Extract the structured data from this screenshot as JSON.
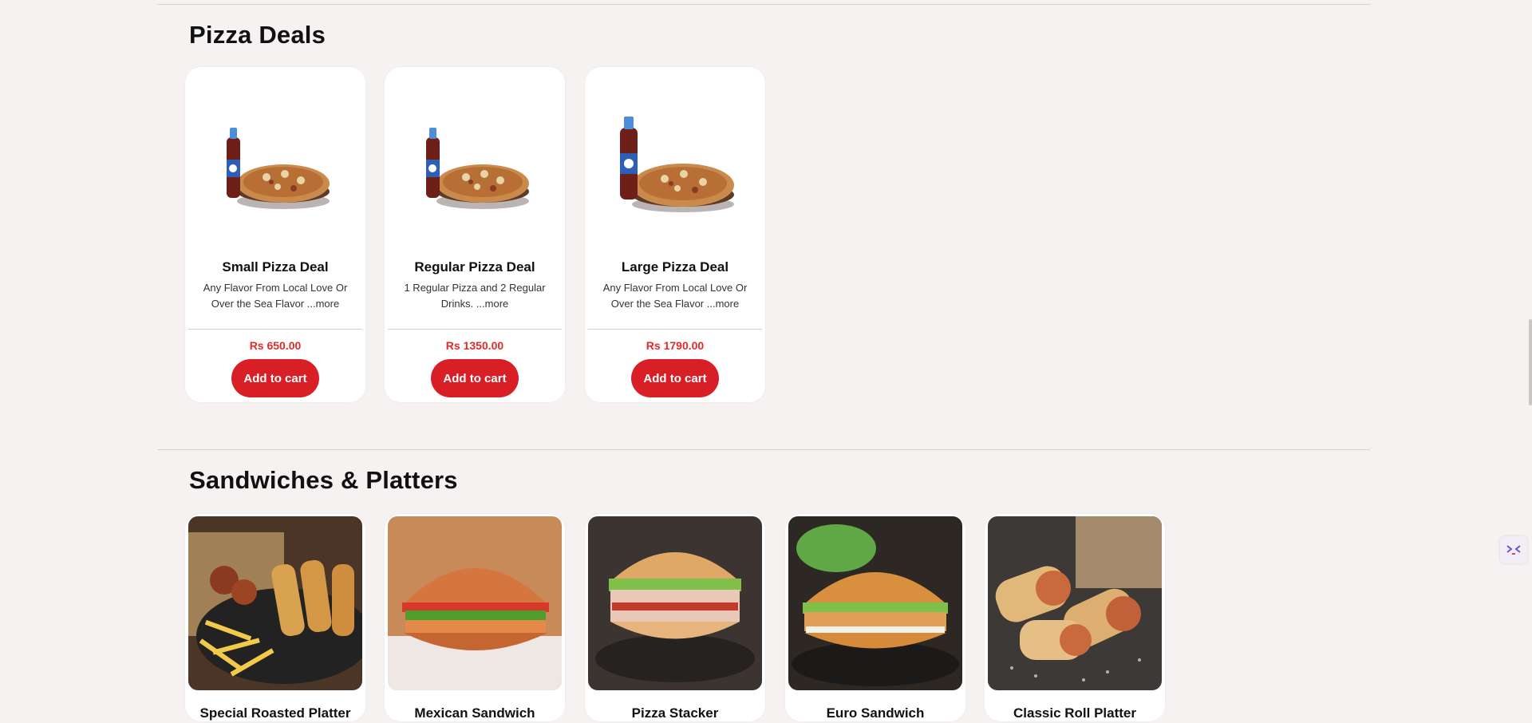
{
  "sections": {
    "pizza_deals": {
      "title": "Pizza Deals",
      "items": [
        {
          "name": "Small Pizza Deal",
          "description": "Any Flavor From Local Love Or Over the Sea Flavor ...more",
          "price": "Rs 650.00",
          "button": "Add to cart"
        },
        {
          "name": "Regular Pizza Deal",
          "description": "1 Regular Pizza and 2 Regular Drinks. ...more",
          "price": "Rs 1350.00",
          "button": "Add to cart"
        },
        {
          "name": "Large Pizza Deal",
          "description": "Any Flavor From Local Love Or Over the Sea Flavor ...more",
          "price": "Rs 1790.00",
          "button": "Add to cart"
        }
      ]
    },
    "sandwiches": {
      "title": "Sandwiches & Platters",
      "items": [
        {
          "name": "Special Roasted Platter"
        },
        {
          "name": "Mexican Sandwich"
        },
        {
          "name": "Pizza Stacker"
        },
        {
          "name": "Euro Sandwich"
        },
        {
          "name": "Classic Roll Platter"
        }
      ]
    }
  },
  "colors": {
    "background": "#f5f2f1",
    "accent_red": "#d91f26",
    "price_red": "#e12a2a"
  },
  "icons": [
    "pizza-deal-image",
    "sandwich-image",
    "chat-widget-icon"
  ]
}
